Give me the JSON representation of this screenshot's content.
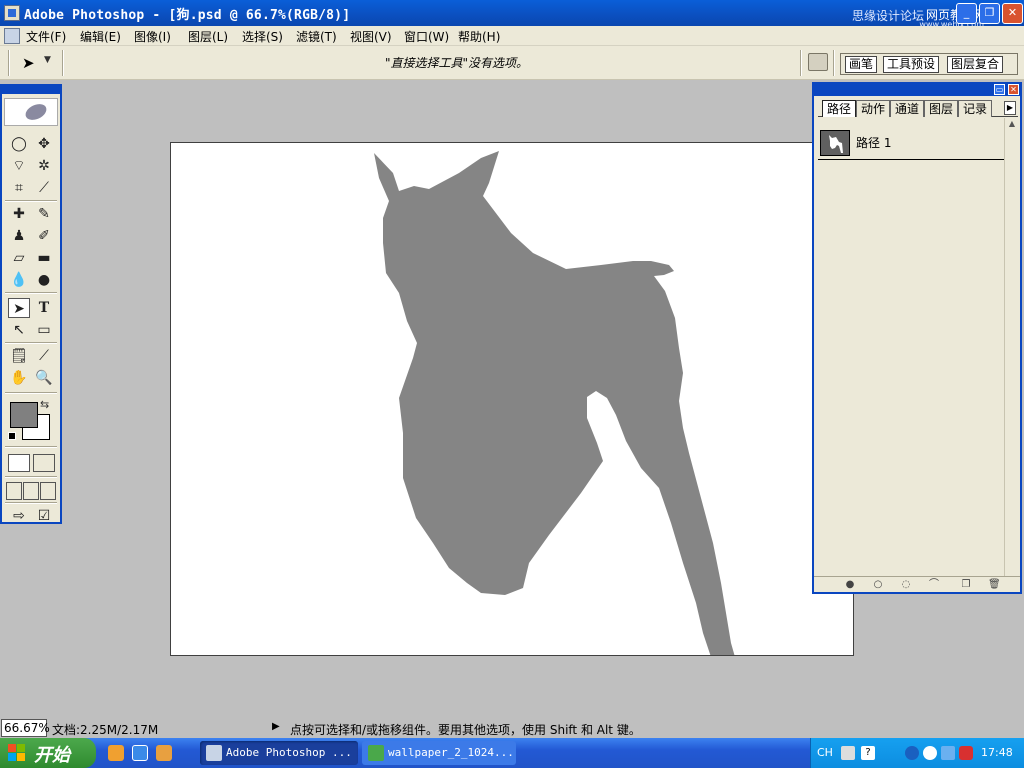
{
  "titlebar": {
    "title": "Adobe Photoshop - [狗.psd @ 66.7%(RGB/8)]",
    "watermark_1": "思缘设计论坛",
    "watermark_2": "网页教学网",
    "watermark_3": "www.webjx.com"
  },
  "menubar": {
    "items": [
      "文件(F)",
      "编辑(E)",
      "图像(I)",
      "图层(L)",
      "选择(S)",
      "滤镜(T)",
      "视图(V)",
      "窗口(W)",
      "帮助(H)"
    ]
  },
  "options_bar": {
    "tool_hint": "\"直接选择工具\"没有选项。",
    "well_tabs": [
      "画笔",
      "工具预设",
      "图层复合"
    ]
  },
  "toolbox": {
    "tools": [
      "elliptical-marquee",
      "move",
      "polygonal-lasso",
      "magic-wand",
      "crop",
      "slice",
      "healing-brush",
      "brush",
      "clone-stamp",
      "history-brush",
      "eraser",
      "gradient",
      "blur",
      "dodge",
      "direct-selection",
      "type",
      "pen",
      "rectangle",
      "notes",
      "eyedropper",
      "hand",
      "zoom"
    ],
    "foreground_color": "#808080",
    "background_color": "#ffffff"
  },
  "document": {
    "silhouette_color": "#858585",
    "canvas_color": "#ffffff"
  },
  "paths_palette": {
    "tabs": [
      "路径",
      "动作",
      "通道",
      "图层",
      "记录"
    ],
    "active_tab": "路径",
    "paths": [
      {
        "name": "路径 1"
      }
    ]
  },
  "statusbar": {
    "zoom": "66.67%",
    "doc_size": "文档:2.25M/2.17M",
    "hint": "点按可选择和/或拖移组件。要用其他选项，使用 Shift 和 Alt 键。"
  },
  "taskbar": {
    "start_label": "开始",
    "tasks": [
      "Adobe Photoshop ...",
      "wallpaper_2_1024..."
    ],
    "lang": "CH",
    "time": "17:48"
  }
}
